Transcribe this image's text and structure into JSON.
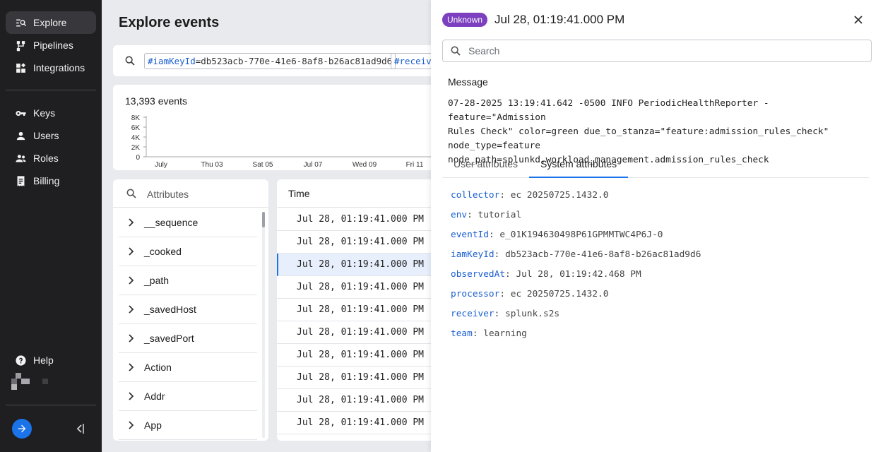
{
  "sidebar": {
    "items": [
      {
        "label": "Explore",
        "icon": "explore-icon"
      },
      {
        "label": "Pipelines",
        "icon": "pipelines-icon"
      },
      {
        "label": "Integrations",
        "icon": "integrations-icon"
      },
      {
        "label": "Keys",
        "icon": "key-icon"
      },
      {
        "label": "Users",
        "icon": "user-icon"
      },
      {
        "label": "Roles",
        "icon": "roles-icon"
      },
      {
        "label": "Billing",
        "icon": "billing-icon"
      }
    ],
    "help_label": "Help"
  },
  "main": {
    "title": "Explore events",
    "query_chips": [
      {
        "key": "#iamKeyId",
        "value": "=db523acb-770e-41e6-8af8-b26ac81ad9d6"
      },
      {
        "key": "#receiv",
        "value": ""
      }
    ],
    "event_count": "13,393 events"
  },
  "chart_data": {
    "type": "bar",
    "y_tick_labels": [
      "8K",
      "6K",
      "4K",
      "2K",
      "0"
    ],
    "x_tick_labels": [
      "July",
      "Thu 03",
      "Sat 05",
      "Jul 07",
      "Wed 09",
      "Fri 11"
    ],
    "ylim": [
      0,
      8000
    ],
    "values": []
  },
  "attributes": {
    "search_placeholder": "Attributes",
    "items": [
      "__sequence",
      "_cooked",
      "_path",
      "_savedHost",
      "_savedPort",
      "Action",
      "Addr",
      "App"
    ]
  },
  "events": {
    "column_header": "Time",
    "rows": [
      "Jul 28, 01:19:41.000 PM",
      "Jul 28, 01:19:41.000 PM",
      "Jul 28, 01:19:41.000 PM",
      "Jul 28, 01:19:41.000 PM",
      "Jul 28, 01:19:41.000 PM",
      "Jul 28, 01:19:41.000 PM",
      "Jul 28, 01:19:41.000 PM",
      "Jul 28, 01:19:41.000 PM",
      "Jul 28, 01:19:41.000 PM",
      "Jul 28, 01:19:41.000 PM"
    ],
    "selected_index": 2
  },
  "detail": {
    "badge": "Unknown",
    "title": "Jul 28, 01:19:41.000 PM",
    "search_placeholder": "Search",
    "message_label": "Message",
    "message": "07-28-2025 13:19:41.642 -0500 INFO PeriodicHealthReporter - feature=\"Admission\nRules Check\" color=green due_to_stanza=\"feature:admission_rules_check\"\nnode_type=feature node_path=splunkd.workload_management.admission_rules_check",
    "tabs": [
      "User attributes",
      "System attributes"
    ],
    "active_tab": "System attributes",
    "system_attributes": [
      {
        "key": "collector",
        "value": "ec 20250725.1432.0"
      },
      {
        "key": "env",
        "value": "tutorial"
      },
      {
        "key": "eventId",
        "value": "e_01K194630498P61GPMMTWC4P6J-0"
      },
      {
        "key": "iamKeyId",
        "value": "db523acb-770e-41e6-8af8-b26ac81ad9d6"
      },
      {
        "key": "observedAt",
        "value": "Jul 28, 01:19:42.468 PM"
      },
      {
        "key": "processor",
        "value": "ec 20250725.1432.0"
      },
      {
        "key": "receiver",
        "value": "splunk.s2s"
      },
      {
        "key": "team",
        "value": "learning"
      }
    ]
  },
  "colors": {
    "sidebar_bg": "#1f1f22",
    "accent": "#1a73e8",
    "badge": "#7b3fbf",
    "attr_key": "#1a5fd0"
  }
}
